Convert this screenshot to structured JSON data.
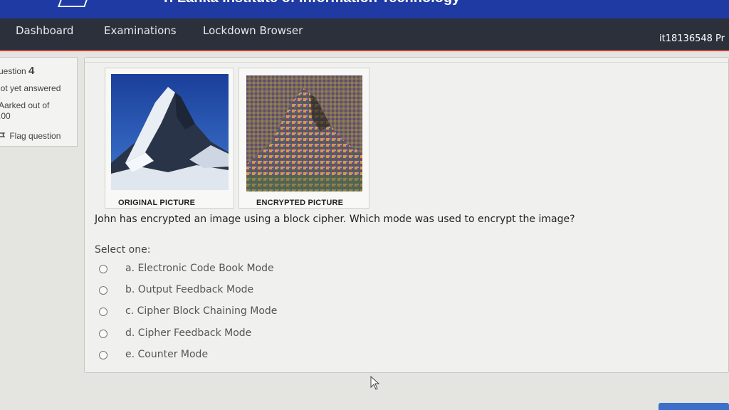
{
  "banner": {
    "title": "ri Lanka Institute of Information Technology"
  },
  "nav": {
    "items": [
      "Dashboard",
      "Examinations",
      "Lockdown Browser"
    ],
    "user_id": "it18136548 Pr"
  },
  "question_info": {
    "label": "uestion",
    "number": "4",
    "status": "lot yet answered",
    "marks_line1": "Aarked out of",
    "marks_line2": ".00",
    "flag_label": "Flag question"
  },
  "images": {
    "original_caption": "ORIGINAL PICTURE",
    "encrypted_caption": "ENCRYPTED PICTURE"
  },
  "question": {
    "text": "John has encrypted an image using a block cipher. Which mode was used to encrypt the image?",
    "select_label": "Select one:",
    "options": [
      "a. Electronic Code Book Mode",
      "b. Output Feedback Mode",
      "c. Cipher Block Chaining Mode",
      "d. Cipher Feedback Mode",
      "e. Counter Mode"
    ]
  }
}
